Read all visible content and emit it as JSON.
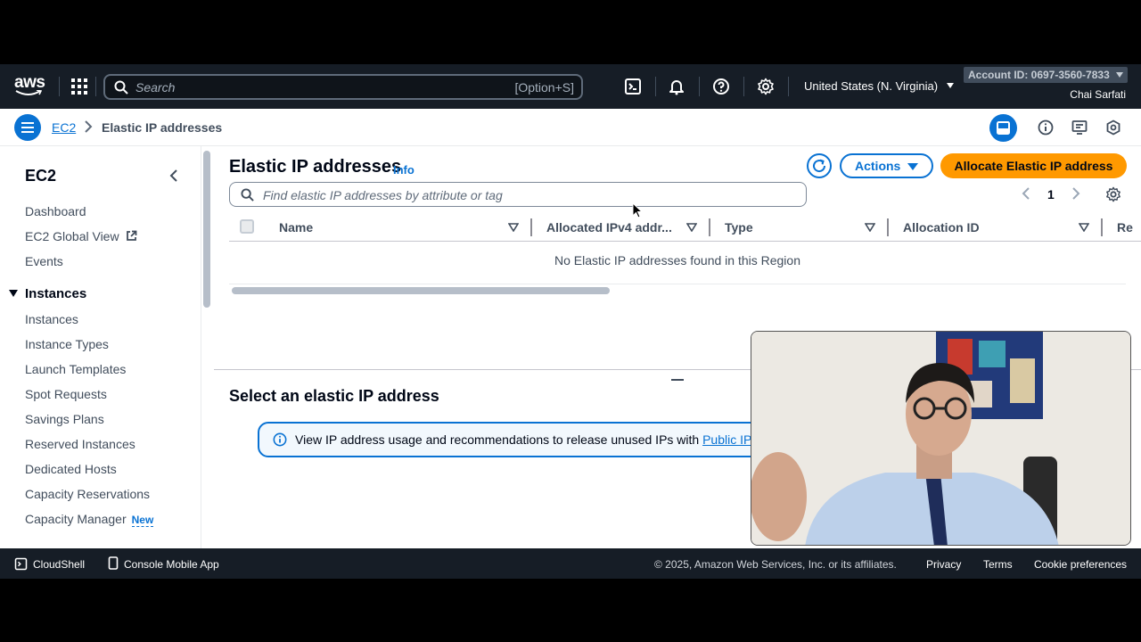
{
  "topnav": {
    "logo_text": "aws",
    "search_placeholder": "Search",
    "search_shortcut": "[Option+S]",
    "region": "United States (N. Virginia)",
    "account_id": "Account ID: 0697-3560-7833",
    "user": "Chai Sarfati"
  },
  "breadcrumb": {
    "parent": "EC2",
    "current": "Elastic IP addresses"
  },
  "sidebar": {
    "title": "EC2",
    "top_items": [
      "Dashboard",
      "EC2 Global View",
      "Events"
    ],
    "section_title": "Instances",
    "section_items": [
      "Instances",
      "Instance Types",
      "Launch Templates",
      "Spot Requests",
      "Savings Plans",
      "Reserved Instances",
      "Dedicated Hosts",
      "Capacity Reservations",
      "Capacity Manager"
    ],
    "new_badge": "New"
  },
  "main": {
    "title": "Elastic IP addresses",
    "info": "Info",
    "actions_label": "Actions",
    "allocate_label": "Allocate Elastic IP address",
    "filter_placeholder": "Find elastic IP addresses by attribute or tag",
    "page_number": "1",
    "columns": [
      "Name",
      "Allocated IPv4 addr...",
      "Type",
      "Allocation ID",
      "Re"
    ],
    "empty_message": "No Elastic IP addresses found in this Region",
    "details_title": "Select an elastic IP address",
    "alert_text": "View IP address usage and recommendations to release unused IPs with ",
    "alert_link": "Public IP"
  },
  "footer": {
    "cloudshell": "CloudShell",
    "mobile_app": "Console Mobile App",
    "copyright": "© 2025, Amazon Web Services, Inc. or its affiliates.",
    "privacy": "Privacy",
    "terms": "Terms",
    "cookies": "Cookie preferences"
  },
  "colors": {
    "nav_bg": "#161d26",
    "link": "#0972d3",
    "primary_button": "#ff9900"
  }
}
